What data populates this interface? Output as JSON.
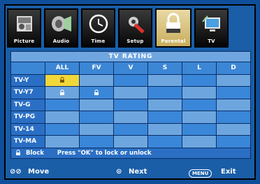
{
  "tabs": [
    {
      "label": "Picture",
      "icon": "picture-icon",
      "active": false
    },
    {
      "label": "Audio",
      "icon": "audio-icon",
      "active": false
    },
    {
      "label": "Time",
      "icon": "clock-icon",
      "active": false
    },
    {
      "label": "Setup",
      "icon": "setup-icon",
      "active": false
    },
    {
      "label": "Parental",
      "icon": "lock-icon",
      "active": true
    },
    {
      "label": "TV",
      "icon": "tv-icon",
      "active": false
    }
  ],
  "table": {
    "title": "TV  RATING",
    "columns": [
      "ALL",
      "FV",
      "V",
      "S",
      "L",
      "D"
    ],
    "rows": [
      "TV-Y",
      "TV-Y7",
      "TV-G",
      "TV-PG",
      "TV-14",
      "TV-MA"
    ],
    "locks": [
      [
        0,
        0
      ],
      [
        1,
        0
      ],
      [
        1,
        1
      ]
    ],
    "selected": [
      0,
      0
    ]
  },
  "legend": {
    "block_label": "Block",
    "hint": "Press \"OK\" to  lock or unlock"
  },
  "nav": {
    "move": "Move",
    "next": "Next",
    "menu_key": "MENU",
    "exit": "Exit"
  },
  "colors": {
    "selected": "#f2d73a",
    "panel": "#1a5ea8"
  }
}
